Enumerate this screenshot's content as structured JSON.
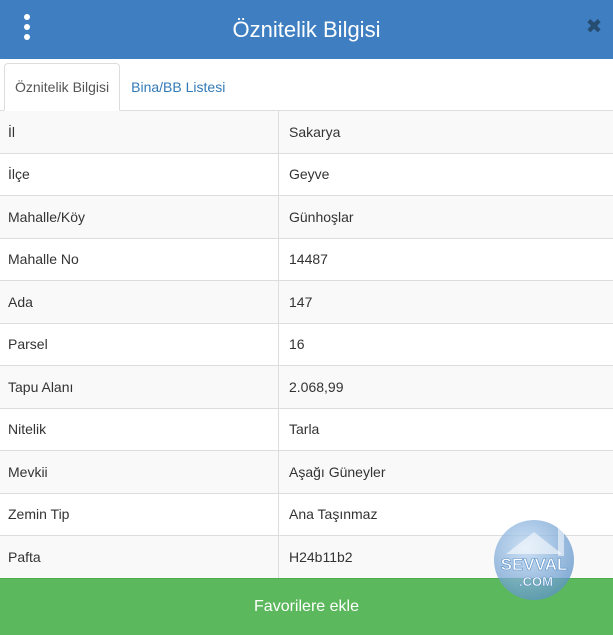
{
  "header": {
    "title": "Öznitelik Bilgisi",
    "close_glyph": "✖"
  },
  "tabs": [
    {
      "label": "Öznitelik Bilgisi",
      "active": true
    },
    {
      "label": "Bina/BB Listesi",
      "active": false
    }
  ],
  "attributes": [
    {
      "key": "İl",
      "value": "Sakarya"
    },
    {
      "key": "İlçe",
      "value": "Geyve"
    },
    {
      "key": "Mahalle/Köy",
      "value": "Günhoşlar"
    },
    {
      "key": "Mahalle No",
      "value": "14487"
    },
    {
      "key": "Ada",
      "value": "147"
    },
    {
      "key": "Parsel",
      "value": "16"
    },
    {
      "key": "Tapu Alanı",
      "value": "2.068,99"
    },
    {
      "key": "Nitelik",
      "value": "Tarla"
    },
    {
      "key": "Mevkii",
      "value": "Aşağı Güneyler"
    },
    {
      "key": "Zemin Tip",
      "value": "Ana Taşınmaz"
    },
    {
      "key": "Pafta",
      "value": "H24b11b2"
    }
  ],
  "footer": {
    "favorite_label": "Favorilere ekle"
  },
  "watermark": {
    "line1": "SEVVAL",
    "line2": ".COM"
  },
  "colors": {
    "header": "#3f7fc1",
    "link": "#337ab7",
    "footer": "#5cb85c"
  }
}
